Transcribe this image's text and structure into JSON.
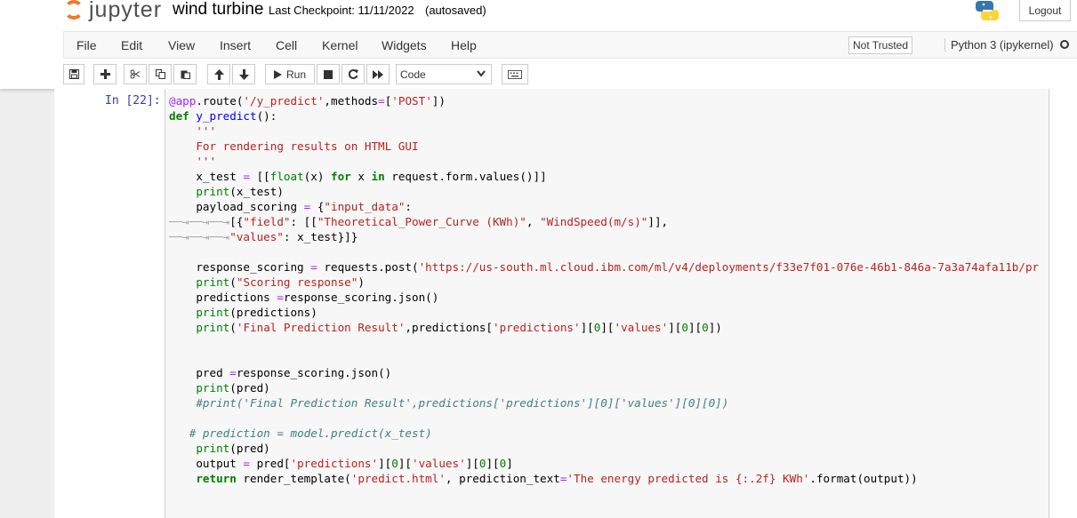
{
  "header": {
    "app_name": "jupyter",
    "notebook_name": "wind turbine",
    "checkpoint": "Last Checkpoint: 11/11/2022",
    "autosave": "(autosaved)",
    "logout_label": "Logout"
  },
  "menubar": {
    "items": [
      "File",
      "Edit",
      "View",
      "Insert",
      "Cell",
      "Kernel",
      "Widgets",
      "Help"
    ],
    "trust_label": "Not Trusted",
    "kernel_label": "Python 3 (ipykernel)"
  },
  "toolbar": {
    "run_label": "Run",
    "cell_type": "Code"
  },
  "cell": {
    "prompt": "In [22]:",
    "code_lines": [
      "@app.route('/y_predict',methods=['POST'])",
      "def y_predict():",
      "    '''",
      "    For rendering results on HTML GUI",
      "    '''",
      "    x_test = [[float(x) for x in request.form.values()]]",
      "    print(x_test)",
      "    payload_scoring = {\"input_data\":",
      "\t\t\t[{\"field\": [[\"Theoretical_Power_Curve (KWh)\", \"WindSpeed(m/s)\"]],",
      "\t\t\t\"values\": x_test}]}",
      "",
      "    response_scoring = requests.post('https://us-south.ml.cloud.ibm.com/ml/v4/deployments/f33e7f01-076e-46b1-846a-7a3a74afa11b/pr",
      "    print(\"Scoring response\")",
      "    predictions =response_scoring.json()",
      "    print(predictions)",
      "    print('Final Prediction Result',predictions['predictions'][0]['values'][0][0])",
      "",
      "",
      "    pred =response_scoring.json()",
      "    print(pred)",
      "    #print('Final Prediction Result',predictions['predictions'][0]['values'][0][0])",
      "",
      "   # prediction = model.predict(x_test)",
      "    print(pred)",
      "    output = pred['predictions'][0]['values'][0][0]",
      "    return render_template('predict.html', prediction_text='The energy predicted is {:.2f} KWh'.format(output))"
    ]
  },
  "colors": {
    "jupyter_orange": "#f37626",
    "prompt_blue": "#303f9f",
    "keyword_green": "#008000",
    "string_red": "#ba2121",
    "comment_teal": "#408080"
  }
}
